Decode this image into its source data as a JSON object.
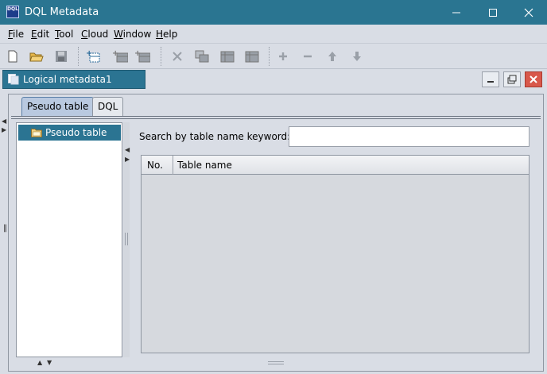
{
  "window": {
    "title": "DQL Metadata",
    "icon_text": "DQL"
  },
  "menu": [
    {
      "label": "File"
    },
    {
      "label": "Edit"
    },
    {
      "label": "Tool"
    },
    {
      "label": "Cloud"
    },
    {
      "label": "Window"
    },
    {
      "label": "Help"
    }
  ],
  "toolbar": [
    {
      "icon": "new-file-icon"
    },
    {
      "icon": "open-folder-icon"
    },
    {
      "icon": "save-icon"
    },
    {
      "icon": "add-pseudo-table-icon"
    },
    {
      "icon": "add-table-icon"
    },
    {
      "icon": "add-table-2-icon"
    },
    {
      "icon": "delete-icon"
    },
    {
      "icon": "copy-table-icon"
    },
    {
      "icon": "table-icon"
    },
    {
      "icon": "table-2-icon"
    },
    {
      "icon": "plus-icon"
    },
    {
      "icon": "minus-icon"
    },
    {
      "icon": "move-up-icon"
    },
    {
      "icon": "move-down-icon"
    }
  ],
  "document": {
    "tab_title": "Logical metadata1"
  },
  "tabs": [
    {
      "label": "Pseudo table",
      "active": true
    },
    {
      "label": "DQL",
      "active": false
    }
  ],
  "tree": {
    "items": [
      {
        "label": "Pseudo table"
      }
    ]
  },
  "search": {
    "label": "Search by table name keyword:",
    "value": "",
    "placeholder": ""
  },
  "table": {
    "columns": [
      "No.",
      "Table name"
    ],
    "rows": []
  },
  "colors": {
    "titlebar": "#2a7591",
    "selection": "#2b7492",
    "background": "#d9dde5"
  }
}
